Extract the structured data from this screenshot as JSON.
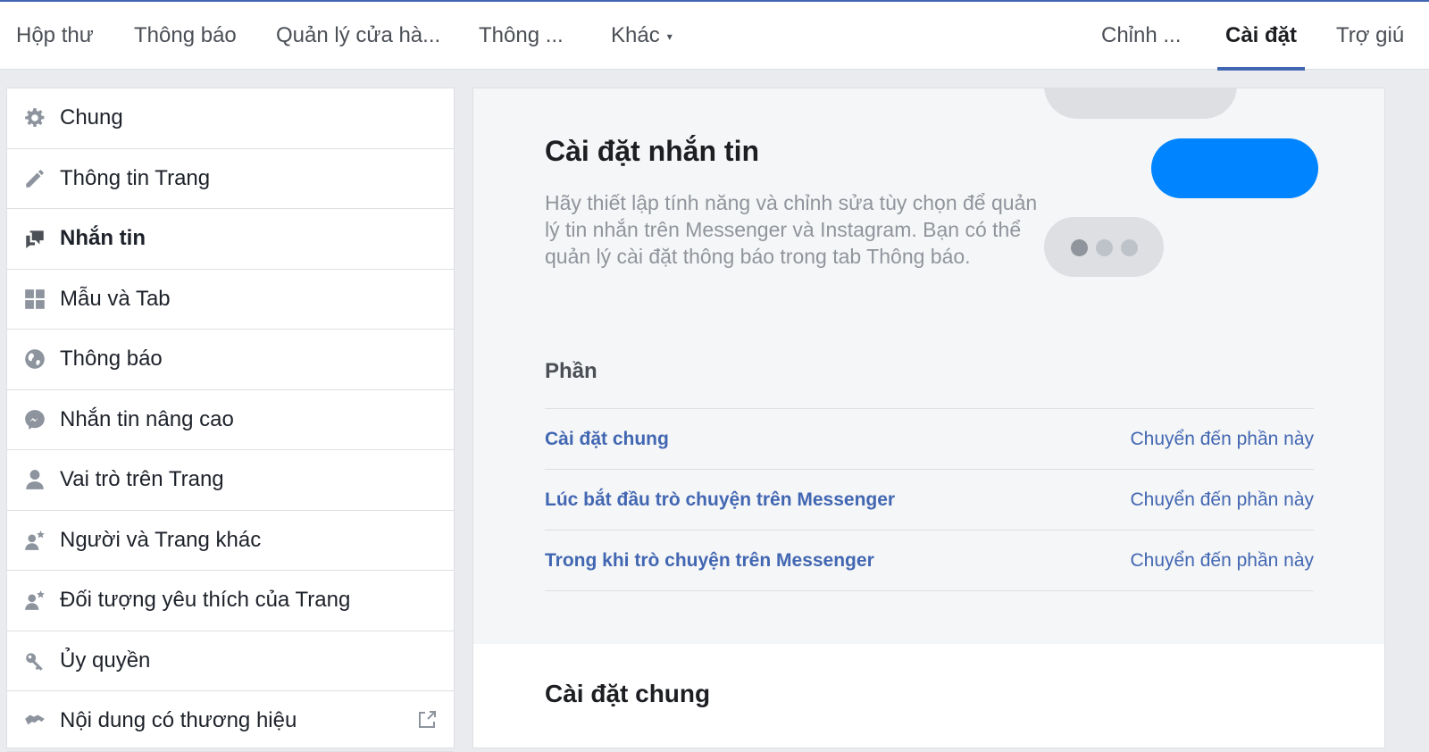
{
  "topnav": {
    "items": [
      {
        "label": "Hộp thư"
      },
      {
        "label": "Thông báo"
      },
      {
        "label": "Quản lý cửa hà..."
      },
      {
        "label": "Thông ..."
      },
      {
        "label": "Khác"
      },
      {
        "label": "Chỉnh ..."
      },
      {
        "label": "Cài đặt"
      },
      {
        "label": "Trợ giú"
      }
    ],
    "more_caret": "▾",
    "accent": "#4267b2"
  },
  "sidebar": {
    "items": [
      {
        "label": "Chung",
        "icon": "gear-icon"
      },
      {
        "label": "Thông tin Trang",
        "icon": "pencil-icon"
      },
      {
        "label": "Nhắn tin",
        "icon": "chat-bubbles-icon",
        "active": true
      },
      {
        "label": "Mẫu và Tab",
        "icon": "grid-icon"
      },
      {
        "label": "Thông báo",
        "icon": "globe-icon"
      },
      {
        "label": "Nhắn tin nâng cao",
        "icon": "messenger-icon"
      },
      {
        "label": "Vai trò trên Trang",
        "icon": "person-icon"
      },
      {
        "label": "Người và Trang khác",
        "icon": "person-star-icon"
      },
      {
        "label": "Đối tượng yêu thích của Trang",
        "icon": "person-star-icon"
      },
      {
        "label": "Ủy quyền",
        "icon": "key-icon"
      },
      {
        "label": "Nội dung có thương hiệu",
        "icon": "handshake-icon",
        "trailing_icon": "external-link-icon"
      }
    ]
  },
  "main": {
    "title": "Cài đặt nhắn tin",
    "description": "Hãy thiết lập tính năng và chỉnh sửa tùy chọn để quản lý tin nhắn trên Messenger và Instagram. Bạn có thể quản lý cài đặt thông báo trong tab Thông báo.",
    "sections_label": "Phần",
    "sections": [
      {
        "title": "Cài đặt chung",
        "link": "Chuyển đến phần này"
      },
      {
        "title": "Lúc bắt đầu trò chuyện trên Messenger",
        "link": "Chuyển đến phần này"
      },
      {
        "title": "Trong khi trò chuyện trên Messenger",
        "link": "Chuyển đến phần này"
      }
    ],
    "subheading": "Cài đặt chung",
    "bubble_blue": "#0084ff"
  }
}
